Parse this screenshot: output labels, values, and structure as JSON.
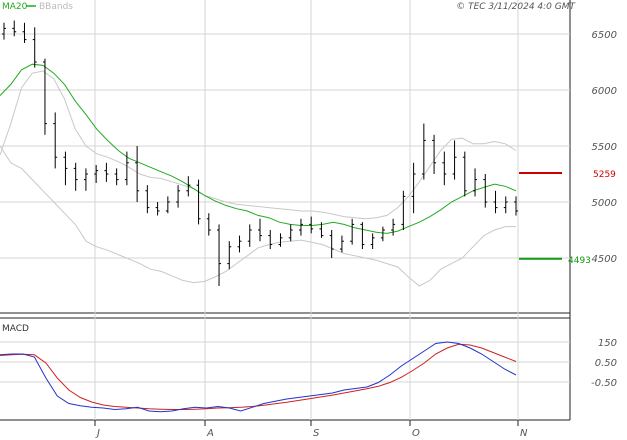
{
  "header": {
    "legend_ma": "MA20",
    "legend_bb": "BBands",
    "copyright": "© TEC 3/11/2024 4:0 GMT"
  },
  "colors": {
    "ma": "#22aa22",
    "bbands": "#c8c8c8",
    "price": "#000000",
    "resistance": "#cc0000",
    "support": "#119911",
    "macd": "#2233cc",
    "signal": "#cc2222",
    "grid": "#d4d4d4"
  },
  "chart_data": [
    {
      "type": "candlestick",
      "title": "",
      "x_ticks": [
        "J",
        "A",
        "S",
        "O",
        "N"
      ],
      "y_ticks": [
        6500,
        6000,
        5500,
        5000,
        4500
      ],
      "ylim": [
        4000,
        6700
      ],
      "levels": {
        "resistance": {
          "label": "5259",
          "value": 5259
        },
        "support": {
          "label": "4493",
          "value": 4493
        }
      },
      "series": [
        {
          "name": "MA20",
          "values": [
            5950,
            6050,
            6180,
            6230,
            6220,
            6150,
            6050,
            5900,
            5780,
            5650,
            5550,
            5460,
            5390,
            5350,
            5310,
            5270,
            5230,
            5180,
            5120,
            5060,
            5010,
            4970,
            4940,
            4920,
            4880,
            4860,
            4820,
            4800,
            4790,
            4790,
            4800,
            4820,
            4800,
            4770,
            4750,
            4730,
            4720,
            4740,
            4780,
            4820,
            4870,
            4930,
            5000,
            5050,
            5100,
            5130,
            5160,
            5140,
            5100
          ]
        },
        {
          "name": "BBands upper",
          "values": [
            5420,
            5700,
            6020,
            6150,
            6170,
            6100,
            5920,
            5650,
            5500,
            5430,
            5400,
            5360,
            5310,
            5250,
            5220,
            5210,
            5180,
            5150,
            5120,
            5060,
            5030,
            5000,
            4980,
            4970,
            4960,
            4950,
            4940,
            4930,
            4920,
            4920,
            4910,
            4890,
            4870,
            4860,
            4850,
            4860,
            4880,
            4950,
            5050,
            5180,
            5320,
            5460,
            5560,
            5570,
            5520,
            5520,
            5540,
            5520,
            5460
          ]
        },
        {
          "name": "BBands lower",
          "values": [
            5500,
            5350,
            5300,
            5200,
            5100,
            5000,
            4900,
            4800,
            4650,
            4600,
            4570,
            4530,
            4490,
            4450,
            4400,
            4380,
            4340,
            4300,
            4280,
            4290,
            4330,
            4380,
            4450,
            4520,
            4590,
            4620,
            4640,
            4650,
            4660,
            4640,
            4620,
            4580,
            4540,
            4520,
            4500,
            4480,
            4450,
            4420,
            4330,
            4250,
            4300,
            4400,
            4450,
            4500,
            4600,
            4700,
            4750,
            4780,
            4780
          ]
        }
      ],
      "ohlc": [
        {
          "o": 6500,
          "h": 6600,
          "l": 6450,
          "c": 6550
        },
        {
          "o": 6550,
          "h": 6620,
          "l": 6480,
          "c": 6520
        },
        {
          "o": 6520,
          "h": 6600,
          "l": 6420,
          "c": 6450
        },
        {
          "o": 6450,
          "h": 6560,
          "l": 6200,
          "c": 6250
        },
        {
          "o": 6250,
          "h": 6280,
          "l": 5600,
          "c": 5700
        },
        {
          "o": 5700,
          "h": 5800,
          "l": 5300,
          "c": 5400
        },
        {
          "o": 5400,
          "h": 5450,
          "l": 5150,
          "c": 5300
        },
        {
          "o": 5300,
          "h": 5350,
          "l": 5100,
          "c": 5200
        },
        {
          "o": 5200,
          "h": 5300,
          "l": 5100,
          "c": 5250
        },
        {
          "o": 5250,
          "h": 5330,
          "l": 5170,
          "c": 5280
        },
        {
          "o": 5280,
          "h": 5350,
          "l": 5180,
          "c": 5250
        },
        {
          "o": 5250,
          "h": 5300,
          "l": 5150,
          "c": 5200
        },
        {
          "o": 5200,
          "h": 5450,
          "l": 5150,
          "c": 5350
        },
        {
          "o": 5350,
          "h": 5500,
          "l": 5000,
          "c": 5100
        },
        {
          "o": 5100,
          "h": 5150,
          "l": 4900,
          "c": 4950
        },
        {
          "o": 4950,
          "h": 5000,
          "l": 4880,
          "c": 4920
        },
        {
          "o": 4920,
          "h": 5050,
          "l": 4900,
          "c": 5000
        },
        {
          "o": 5000,
          "h": 5150,
          "l": 4950,
          "c": 5100
        },
        {
          "o": 5100,
          "h": 5230,
          "l": 5050,
          "c": 5150
        },
        {
          "o": 5150,
          "h": 5200,
          "l": 4800,
          "c": 4850
        },
        {
          "o": 4850,
          "h": 4900,
          "l": 4700,
          "c": 4750
        },
        {
          "o": 4750,
          "h": 4800,
          "l": 4250,
          "c": 4450
        },
        {
          "o": 4450,
          "h": 4650,
          "l": 4400,
          "c": 4600
        },
        {
          "o": 4600,
          "h": 4700,
          "l": 4550,
          "c": 4650
        },
        {
          "o": 4650,
          "h": 4800,
          "l": 4600,
          "c": 4750
        },
        {
          "o": 4750,
          "h": 4850,
          "l": 4650,
          "c": 4700
        },
        {
          "o": 4700,
          "h": 4750,
          "l": 4580,
          "c": 4620
        },
        {
          "o": 4620,
          "h": 4720,
          "l": 4600,
          "c": 4680
        },
        {
          "o": 4680,
          "h": 4800,
          "l": 4650,
          "c": 4750
        },
        {
          "o": 4750,
          "h": 4850,
          "l": 4700,
          "c": 4800
        },
        {
          "o": 4800,
          "h": 4870,
          "l": 4720,
          "c": 4760
        },
        {
          "o": 4760,
          "h": 4820,
          "l": 4680,
          "c": 4700
        },
        {
          "o": 4700,
          "h": 4750,
          "l": 4500,
          "c": 4580
        },
        {
          "o": 4580,
          "h": 4700,
          "l": 4550,
          "c": 4650
        },
        {
          "o": 4650,
          "h": 4850,
          "l": 4620,
          "c": 4800
        },
        {
          "o": 4800,
          "h": 4820,
          "l": 4580,
          "c": 4620
        },
        {
          "o": 4620,
          "h": 4720,
          "l": 4580,
          "c": 4680
        },
        {
          "o": 4680,
          "h": 4780,
          "l": 4650,
          "c": 4750
        },
        {
          "o": 4750,
          "h": 4850,
          "l": 4700,
          "c": 4800
        },
        {
          "o": 4800,
          "h": 5100,
          "l": 4750,
          "c": 5050
        },
        {
          "o": 5050,
          "h": 5350,
          "l": 4900,
          "c": 5250
        },
        {
          "o": 5250,
          "h": 5700,
          "l": 5200,
          "c": 5550
        },
        {
          "o": 5550,
          "h": 5600,
          "l": 5250,
          "c": 5350
        },
        {
          "o": 5350,
          "h": 5450,
          "l": 5150,
          "c": 5250
        },
        {
          "o": 5250,
          "h": 5550,
          "l": 5200,
          "c": 5400
        },
        {
          "o": 5400,
          "h": 5450,
          "l": 5050,
          "c": 5100
        },
        {
          "o": 5100,
          "h": 5300,
          "l": 5050,
          "c": 5200
        },
        {
          "o": 5200,
          "h": 5250,
          "l": 4950,
          "c": 5000
        },
        {
          "o": 5000,
          "h": 5100,
          "l": 4900,
          "c": 4950
        },
        {
          "o": 4950,
          "h": 5050,
          "l": 4900,
          "c": 5000
        },
        {
          "o": 5000,
          "h": 5050,
          "l": 4880,
          "c": 4920
        }
      ]
    },
    {
      "type": "line",
      "title": "MACD",
      "y_ticks": [
        "150",
        "0.50",
        "-0.50"
      ],
      "series": [
        {
          "name": "MACD",
          "values": [
            75,
            80,
            80,
            60,
            -80,
            -200,
            -250,
            -265,
            -275,
            -280,
            -290,
            -285,
            -275,
            -300,
            -305,
            -300,
            -285,
            -275,
            -280,
            -270,
            -280,
            -300,
            -275,
            -250,
            -235,
            -220,
            -210,
            -200,
            -190,
            -180,
            -160,
            -150,
            -140,
            -110,
            -60,
            0,
            50,
            100,
            150,
            160,
            150,
            120,
            80,
            30,
            -20,
            -60
          ]
        },
        {
          "name": "Signal",
          "values": [
            70,
            75,
            78,
            75,
            20,
            -80,
            -160,
            -210,
            -240,
            -260,
            -270,
            -275,
            -280,
            -285,
            -288,
            -290,
            -290,
            -288,
            -285,
            -280,
            -278,
            -275,
            -270,
            -262,
            -252,
            -242,
            -230,
            -218,
            -206,
            -194,
            -180,
            -166,
            -152,
            -135,
            -110,
            -75,
            -30,
            20,
            80,
            120,
            145,
            140,
            120,
            90,
            60,
            30
          ]
        }
      ]
    }
  ]
}
